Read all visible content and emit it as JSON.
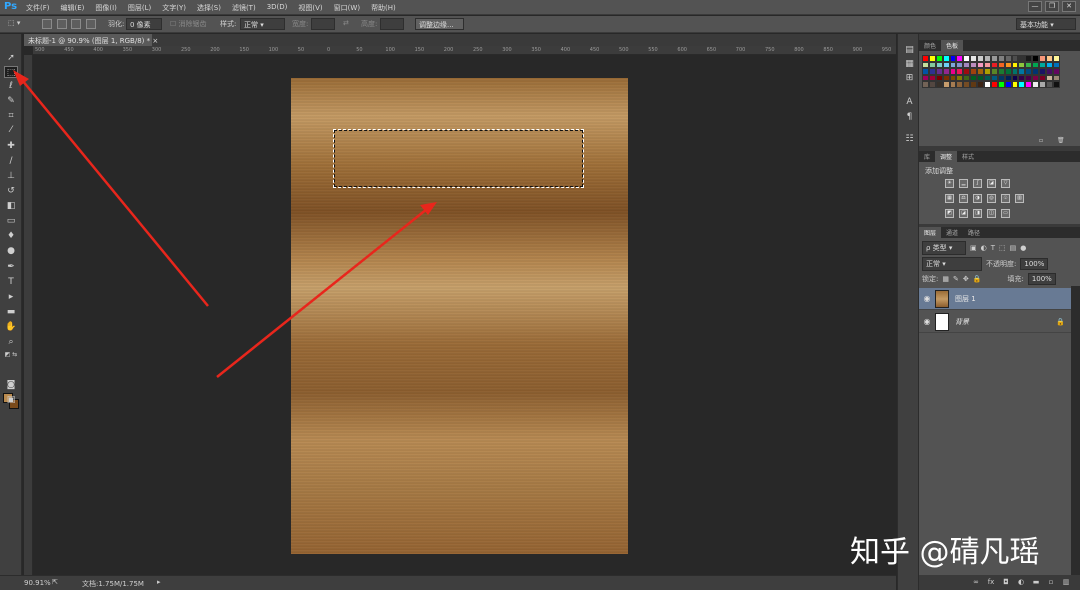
{
  "app": {
    "logo": "Ps",
    "menu": [
      "文件(F)",
      "编辑(E)",
      "图像(I)",
      "图层(L)",
      "文字(Y)",
      "选择(S)",
      "滤镜(T)",
      "3D(D)",
      "视图(V)",
      "窗口(W)",
      "帮助(H)"
    ],
    "window_controls": [
      "—",
      "❐",
      "✕"
    ]
  },
  "options_bar": {
    "feather_label": "羽化:",
    "feather_value": "0 像素",
    "antialias_label": "消除锯齿",
    "style_label": "样式:",
    "style_value": "正常",
    "width_label": "宽度:",
    "height_label": "高度:",
    "refine_button": "调整边缘...",
    "workspace": "基本功能"
  },
  "document": {
    "tab_title": "未标题-1 @ 90.9% (图层 1, RGB/8) *",
    "ruler_ticks": [
      "500",
      "450",
      "400",
      "350",
      "300",
      "250",
      "200",
      "150",
      "100",
      "50",
      "0",
      "50",
      "100",
      "150",
      "200",
      "250",
      "300",
      "350",
      "400",
      "450",
      "500",
      "550",
      "600",
      "650",
      "700",
      "750",
      "800",
      "850",
      "900",
      "950"
    ]
  },
  "status": {
    "zoom": "90.91%",
    "doc_info": "文档:1.75M/1.75M"
  },
  "panels": {
    "color_tabs": [
      "颜色",
      "色板"
    ],
    "swatch_colors": [
      "#ff0000",
      "#ffff00",
      "#00ff00",
      "#00ffff",
      "#0000ff",
      "#ff00ff",
      "#ffffff",
      "#e6e6e6",
      "#cccccc",
      "#b3b3b3",
      "#999999",
      "#808080",
      "#666666",
      "#4d4d4d",
      "#333333",
      "#1a1a1a",
      "#000000",
      "#f7977a",
      "#fdc68a",
      "#fff79a",
      "#c4df9b",
      "#82ca9d",
      "#7bcdc8",
      "#6ecff6",
      "#7ea7d8",
      "#8493ca",
      "#a187be",
      "#bc8dbf",
      "#f49ac2",
      "#f6989d",
      "#ed1c24",
      "#f26522",
      "#f7941d",
      "#fff200",
      "#8dc63f",
      "#39b54a",
      "#00a651",
      "#00a99d",
      "#00aeef",
      "#0072bc",
      "#0054a6",
      "#2e3192",
      "#662d91",
      "#92278f",
      "#ec008c",
      "#ed145b",
      "#9e0b0f",
      "#a0410d",
      "#a36209",
      "#aba000",
      "#598527",
      "#1a7b30",
      "#007236",
      "#00746b",
      "#0076a3",
      "#004b80",
      "#003471",
      "#1b1464",
      "#440e62",
      "#630460",
      "#9e005d",
      "#9e0039",
      "#790000",
      "#7b2e00",
      "#7d4900",
      "#827b00",
      "#406618",
      "#005e20",
      "#005826",
      "#005952",
      "#005b7f",
      "#003663",
      "#002157",
      "#0d004c",
      "#32004b",
      "#4b0049",
      "#7b0046",
      "#7a0026",
      "#c7b299",
      "#998675",
      "#736357",
      "#534741",
      "#37302a",
      "#c69c6d",
      "#a67c52",
      "#8c6239",
      "#754c24",
      "#603913",
      "#3c2415",
      "#ffffff",
      "#ff0000",
      "#00ff00",
      "#0000ff",
      "#ffff00",
      "#00ffff",
      "#ff00ff",
      "#eeeeee",
      "#aaaaaa",
      "#555555",
      "#111111"
    ],
    "adjust_tabs": [
      "库",
      "调整",
      "样式"
    ],
    "adjust_label": "添加调整",
    "layer_tabs": [
      "图层",
      "通道",
      "路径"
    ],
    "layer_filter": "ρ 类型",
    "blend_mode": "正常",
    "opacity_label": "不透明度:",
    "opacity_value": "100%",
    "lock_label": "锁定:",
    "fill_label": "填充:",
    "fill_value": "100%",
    "layers": [
      {
        "name": "图层 1",
        "selected": true
      },
      {
        "name": "背景",
        "selected": false
      }
    ]
  },
  "watermark": "知乎 @碃凡瑶",
  "colors": {
    "ui_bg": "#535353",
    "workspace": "#282828",
    "arrow": "#e8261c",
    "selected_layer": "#687a94"
  }
}
